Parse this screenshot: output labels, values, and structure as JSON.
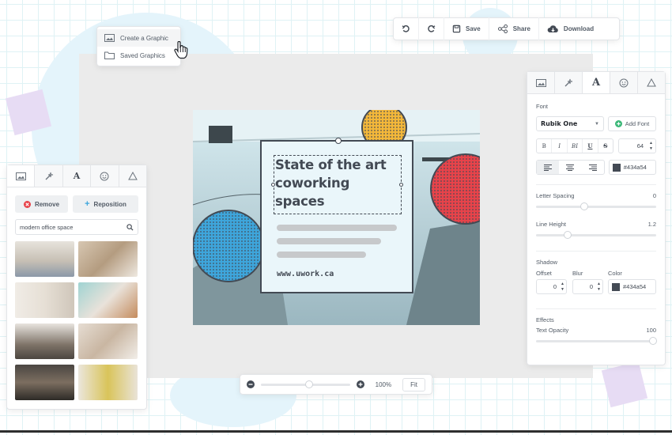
{
  "toolbar": {
    "save": "Save",
    "share": "Share",
    "download": "Download"
  },
  "menu": {
    "items": [
      {
        "label": "Create a Graphic",
        "icon": "image-icon"
      },
      {
        "label": "Saved Graphics",
        "icon": "folder-icon"
      }
    ]
  },
  "left_panel": {
    "tabs": [
      "image-icon",
      "magic-wand-icon",
      "text-icon",
      "smiley-icon",
      "shape-icon"
    ],
    "remove_label": "Remove",
    "reposition_label": "Reposition",
    "search_value": "modern office space"
  },
  "design": {
    "headline": "State of the art coworking spaces",
    "url": "www.uwork.ca",
    "colors": {
      "yellow": "#f4b83a",
      "red": "#e8434a",
      "blue": "#3ea6dc",
      "ink": "#434a54"
    }
  },
  "right_panel": {
    "font_heading": "Font",
    "font_family": "Rubik One",
    "add_font": "Add Font",
    "style_buttons": [
      "B",
      "I",
      "BI",
      "U",
      "S"
    ],
    "font_size": "64",
    "text_color": "#434a54",
    "letter_spacing_label": "Letter Spacing",
    "letter_spacing_value": "0",
    "line_height_label": "Line Height",
    "line_height_value": "1.2",
    "shadow_heading": "Shadow",
    "offset_label": "Offset",
    "blur_label": "Blur",
    "color_label": "Color",
    "offset_value": "0",
    "blur_value": "0",
    "shadow_color": "#434a54",
    "effects_heading": "Effects",
    "text_opacity_label": "Text Opacity",
    "text_opacity_value": "100"
  },
  "zoom": {
    "percent": "100%",
    "fit": "Fit",
    "level": 0.5
  }
}
